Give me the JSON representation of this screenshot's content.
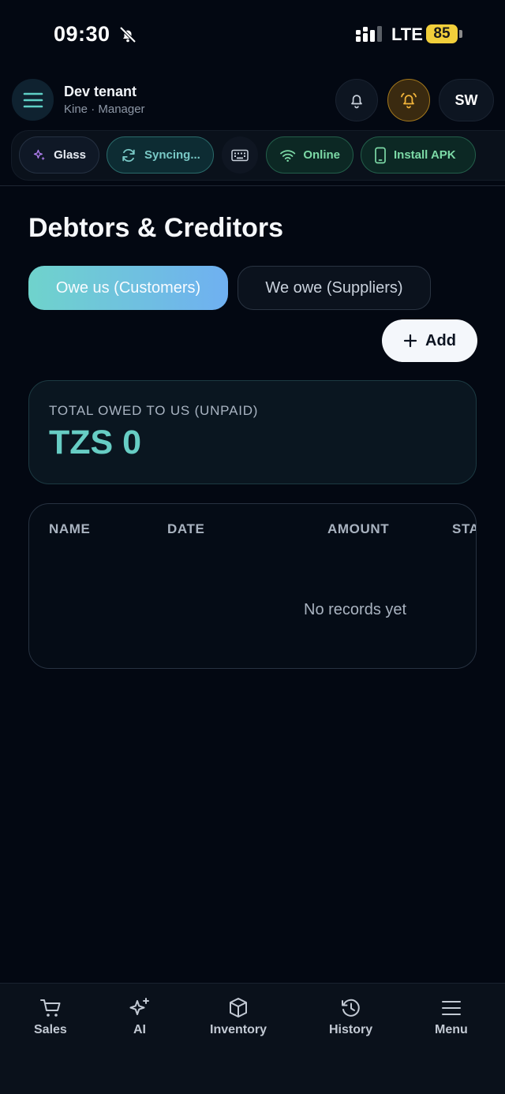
{
  "status_bar": {
    "time": "09:30",
    "network": "LTE",
    "battery": "85"
  },
  "header": {
    "tenant_name": "Dev tenant",
    "tenant_sub": "Kine · Manager",
    "avatar_initials": "SW"
  },
  "chips": {
    "glass": "Glass",
    "sync": "Syncing...",
    "online": "Online",
    "install": "Install APK"
  },
  "page": {
    "title": "Debtors & Creditors",
    "tab_customers": "Owe us (Customers)",
    "tab_suppliers": "We owe (Suppliers)",
    "add_label": "Add"
  },
  "summary": {
    "label": "TOTAL OWED TO US (UNPAID)",
    "value": "TZS 0"
  },
  "table": {
    "columns": [
      "NAME",
      "DATE",
      "AMOUNT",
      "STA"
    ],
    "empty_message": "No records yet"
  },
  "bottom_nav": {
    "items": [
      "Sales",
      "AI",
      "Inventory",
      "History",
      "Menu"
    ]
  },
  "colors": {
    "accent_teal": "#67cdc4",
    "alert_amber": "#f2b43a",
    "online_green": "#7cd9a6",
    "battery_yellow": "#f2cf3b"
  }
}
